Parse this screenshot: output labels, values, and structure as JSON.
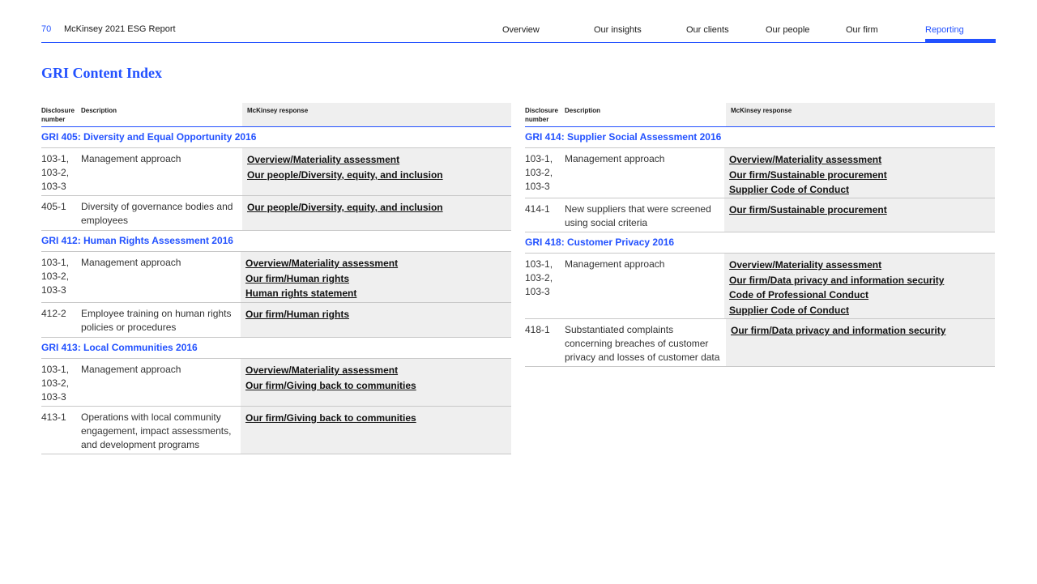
{
  "header": {
    "page_number": "70",
    "report_title": "McKinsey 2021 ESG Report",
    "nav": [
      {
        "label": "Overview"
      },
      {
        "label": "Our insights"
      },
      {
        "label": "Our clients"
      },
      {
        "label": "Our people"
      },
      {
        "label": "Our firm"
      },
      {
        "label": "Reporting",
        "active": true
      }
    ]
  },
  "page_title": "GRI Content Index",
  "colors": {
    "accent": "#2251ff",
    "response_bg": "#efefef",
    "rule": "#c8c8c8"
  },
  "table_headers": {
    "disclosure": "Disclosure number",
    "description": "Description",
    "response": "McKinsey response"
  },
  "left_table": [
    {
      "section": "GRI 405: Diversity and Equal Opportunity 2016",
      "rows": [
        {
          "code": "103-1, 103-2, 103-3",
          "description": "Management approach",
          "links": [
            "Overview/Materiality assessment",
            "Our people/Diversity, equity, and inclusion"
          ]
        },
        {
          "code": "405-1",
          "description": "Diversity of governance bodies and employees",
          "links": [
            "Our people/Diversity, equity, and inclusion"
          ]
        }
      ]
    },
    {
      "section": "GRI 412: Human Rights Assessment 2016",
      "rows": [
        {
          "code": "103-1, 103-2, 103-3",
          "description": "Management approach",
          "links": [
            "Overview/Materiality assessment",
            "Our firm/Human rights",
            "Human rights statement"
          ]
        },
        {
          "code": "412-2",
          "description": "Employee training on human rights policies or procedures",
          "links": [
            "Our firm/Human rights"
          ]
        }
      ]
    },
    {
      "section": "GRI 413: Local Communities 2016",
      "rows": [
        {
          "code": "103-1, 103-2, 103-3",
          "description": "Management approach",
          "links": [
            "Overview/Materiality assessment",
            "Our firm/Giving back to communities"
          ]
        },
        {
          "code": "413-1",
          "description": "Operations with local community engagement, impact assessments, and development programs",
          "links": [
            "Our firm/Giving back to communities"
          ]
        }
      ]
    }
  ],
  "right_table": [
    {
      "section": "GRI 414: Supplier Social Assessment 2016",
      "rows": [
        {
          "code": "103-1, 103-2, 103-3",
          "description": "Management approach",
          "links": [
            "Overview/Materiality assessment",
            "Our firm/Sustainable procurement",
            "Supplier Code of Conduct"
          ]
        },
        {
          "code": "414-1",
          "description": "New suppliers that were screened using social criteria",
          "links": [
            "Our firm/Sustainable procurement"
          ]
        }
      ]
    },
    {
      "section": "GRI 418: Customer Privacy 2016",
      "rows": [
        {
          "code": "103-1, 103-2, 103-3",
          "description": "Management approach",
          "links": [
            "Overview/Materiality assessment",
            "Our firm/Data privacy and information security",
            "Code of Professional Conduct",
            "Supplier Code of Conduct"
          ]
        },
        {
          "code": "418-1",
          "description": "Substantiated complaints concerning breaches of customer privacy and losses of customer data",
          "links": [
            "Our firm/Data privacy and information security"
          ]
        }
      ]
    }
  ]
}
